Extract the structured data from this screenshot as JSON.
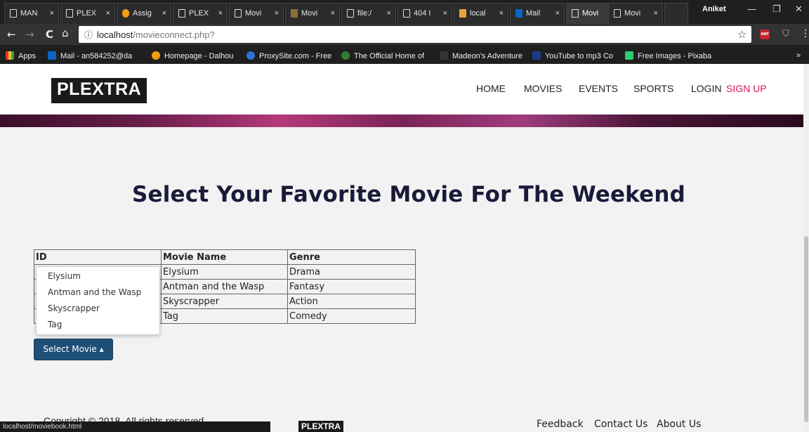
{
  "browser": {
    "tabs": [
      {
        "label": "MAN",
        "close": "×"
      },
      {
        "label": "PLEX",
        "close": "×"
      },
      {
        "label": "Assig",
        "close": "×"
      },
      {
        "label": "PLEX",
        "close": "×"
      },
      {
        "label": "Movi",
        "close": "×"
      },
      {
        "label": "Movi",
        "close": "×"
      },
      {
        "label": "file:/",
        "close": "×"
      },
      {
        "label": "404 I",
        "close": "×"
      },
      {
        "label": "local",
        "close": "×"
      },
      {
        "label": "Mail",
        "close": "×"
      },
      {
        "label": "Movi",
        "close": "×"
      },
      {
        "label": "Movi",
        "close": "×"
      }
    ],
    "profile_name": "Aniket",
    "minimize": "—",
    "restore": "❐",
    "close": "✕",
    "back": "←",
    "forward": "→",
    "reload": "C",
    "home": "⌂",
    "info_icon": "ⓘ",
    "url_host": "localhost",
    "url_path": "/movieconnect.php?",
    "star": "☆",
    "abp_label": "ABP",
    "shield": "⛉",
    "menu": "⋮",
    "bookmarks": [
      {
        "label": "Apps",
        "color": "#e53935"
      },
      {
        "label": "Mail - an584252@da",
        "color": "#0a66c2"
      },
      {
        "label": "Homepage - Dalhou",
        "color": "#f39c12"
      },
      {
        "label": "ProxySite.com - Free",
        "color": "#2f6fd6"
      },
      {
        "label": "The Official Home of",
        "color": "#2e7d32"
      },
      {
        "label": "Madeon's Adventure",
        "color": "#333333"
      },
      {
        "label": "YouTube to mp3 Co",
        "color": "#1e3a8a"
      },
      {
        "label": "Free Images - Pixaba",
        "color": "#2ecc71"
      }
    ],
    "bookmarks_more": "»",
    "status_url": "localhost/moviebook.html"
  },
  "site": {
    "logo": "PLEXTRA",
    "nav": [
      "HOME",
      "MOVIES",
      "EVENTS",
      "SPORTS",
      "LOGIN",
      "SIGN UP"
    ],
    "accent_color": "#e0115f",
    "headline": "Select Your Favorite Movie For The Weekend",
    "table": {
      "headers": [
        "ID",
        "Movie Name",
        "Genre"
      ],
      "rows": [
        [
          "",
          "Elysium",
          "Drama"
        ],
        [
          "",
          "Antman and the Wasp",
          "Fantasy"
        ],
        [
          "",
          "Skyscrapper",
          "Action"
        ],
        [
          "",
          "Tag",
          "Comedy"
        ]
      ]
    },
    "dropdown_options": [
      "Elysium",
      "Antman and the Wasp",
      "Skyscrapper",
      "Tag"
    ],
    "select_button": "Select Movie ▴",
    "button_color": "#1e4f79",
    "footer_copyright": "Copyright © 2018, All rights reserved",
    "footer_logo": "PLEXTRA",
    "footer_links": [
      "Feedback",
      "Contact Us",
      "About Us"
    ]
  }
}
